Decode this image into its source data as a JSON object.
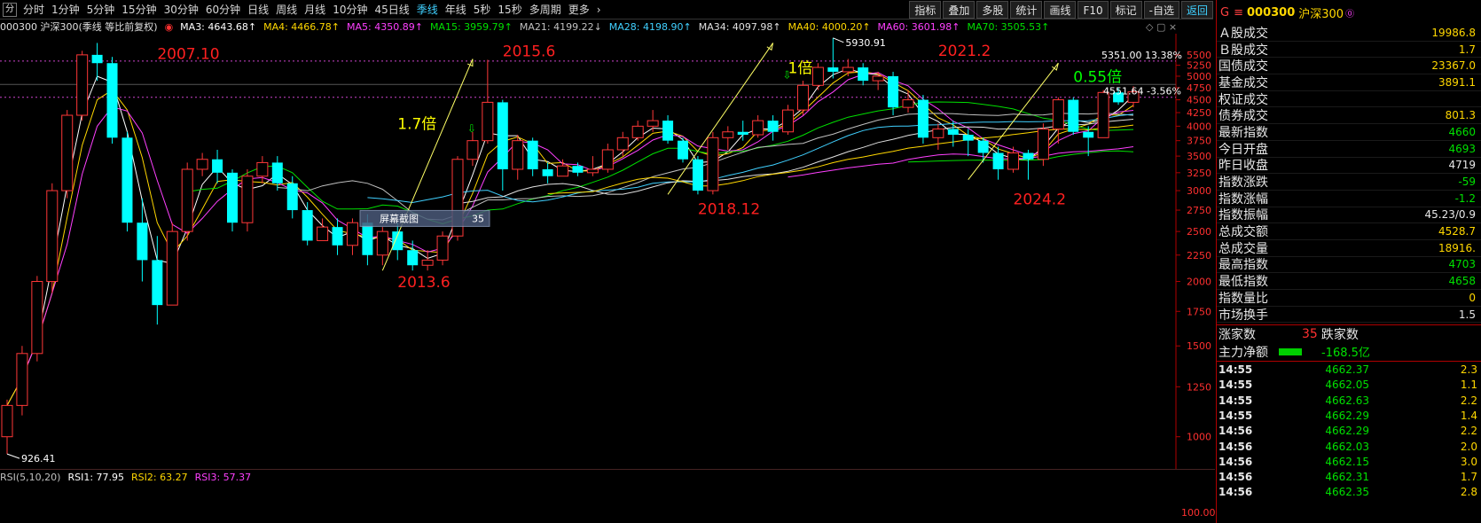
{
  "toolbar": {
    "first_icon": "分",
    "periods": [
      "分时",
      "1分钟",
      "5分钟",
      "15分钟",
      "30分钟",
      "60分钟",
      "日线",
      "周线",
      "月线",
      "10分钟",
      "45日线",
      "季线",
      "年线",
      "5秒",
      "15秒",
      "多周期",
      "更多"
    ],
    "active_period": "季线",
    "more_arrow": "›",
    "tools": [
      "指标",
      "叠加",
      "多股",
      "统计",
      "画线",
      "F10",
      "标记",
      "-自选",
      "返回"
    ]
  },
  "ma_bar": {
    "title": "000300 沪深300(季线 等比前复权)",
    "items": [
      {
        "label": "MA3: 4643.68↑",
        "color": "#ffffff"
      },
      {
        "label": "MA4: 4466.78↑",
        "color": "#ffd700"
      },
      {
        "label": "MA5: 4350.89↑",
        "color": "#ff40ff"
      },
      {
        "label": "MA15: 3959.79↑",
        "color": "#00e000"
      },
      {
        "label": "MA21: 4199.22↓",
        "color": "#c0c0c0"
      },
      {
        "label": "MA28: 4198.90↑",
        "color": "#40d0ff"
      },
      {
        "label": "MA34: 4097.98↑",
        "color": "#e0e0e0"
      },
      {
        "label": "MA40: 4000.20↑",
        "color": "#ffd700"
      },
      {
        "label": "MA60: 3601.98↑",
        "color": "#ff40ff"
      },
      {
        "label": "MA70: 3505.53↑",
        "color": "#00e000"
      }
    ],
    "window_icons": "◇ ▢ ×"
  },
  "chart_data": {
    "type": "candlestick",
    "period": "季线",
    "y_ticks": [
      5500,
      5250,
      5000,
      4750,
      4500,
      4250,
      4000,
      3750,
      3500,
      3250,
      3000,
      2750,
      2500,
      2250,
      2000,
      1750,
      1500,
      1250,
      1000
    ],
    "ylim": [
      880,
      5950
    ],
    "candles": [
      [
        1000,
        1150,
        926,
        1180
      ],
      [
        1150,
        1450,
        1100,
        1500
      ],
      [
        1450,
        2000,
        1400,
        2050
      ],
      [
        2000,
        3000,
        1900,
        3100
      ],
      [
        3000,
        4200,
        2900,
        4300
      ],
      [
        4200,
        5500,
        4100,
        5600
      ],
      [
        5500,
        5300,
        4900,
        5800
      ],
      [
        5300,
        3800,
        3700,
        5450
      ],
      [
        3800,
        2600,
        2500,
        3900
      ],
      [
        2600,
        2200,
        2000,
        2900
      ],
      [
        2200,
        1800,
        1650,
        2450
      ],
      [
        1800,
        2500,
        1800,
        2600
      ],
      [
        2500,
        3300,
        2400,
        3400
      ],
      [
        3300,
        3450,
        3200,
        3550
      ],
      [
        3450,
        3250,
        3100,
        3600
      ],
      [
        3250,
        2600,
        2500,
        3300
      ],
      [
        2600,
        3200,
        2500,
        3300
      ],
      [
        3200,
        3400,
        3100,
        3500
      ],
      [
        3400,
        3100,
        3000,
        3500
      ],
      [
        3100,
        2750,
        2650,
        3200
      ],
      [
        2750,
        2400,
        2350,
        2850
      ],
      [
        2400,
        2550,
        2400,
        2650
      ],
      [
        2550,
        2350,
        2250,
        2650
      ],
      [
        2350,
        2600,
        2250,
        2650
      ],
      [
        2600,
        2250,
        2150,
        2700
      ],
      [
        2250,
        2500,
        2150,
        2550
      ],
      [
        2500,
        2300,
        2200,
        2600
      ],
      [
        2300,
        2150,
        2100,
        2400
      ],
      [
        2150,
        2200,
        2100,
        2300
      ],
      [
        2200,
        2450,
        2150,
        2500
      ],
      [
        2450,
        3450,
        2400,
        3500
      ],
      [
        3450,
        3750,
        3350,
        3900
      ],
      [
        3750,
        4450,
        3700,
        5380
      ],
      [
        4450,
        3300,
        3000,
        4500
      ],
      [
        3300,
        3750,
        3150,
        3850
      ],
      [
        3750,
        3300,
        3200,
        3800
      ],
      [
        3300,
        3200,
        3100,
        3400
      ],
      [
        3200,
        3350,
        3200,
        3450
      ],
      [
        3350,
        3250,
        3200,
        3400
      ],
      [
        3250,
        3300,
        3200,
        3500
      ],
      [
        3300,
        3600,
        3250,
        3700
      ],
      [
        3600,
        3800,
        3500,
        3900
      ],
      [
        3800,
        4000,
        3750,
        4100
      ],
      [
        4000,
        4100,
        3900,
        4300
      ],
      [
        4100,
        3750,
        3700,
        4200
      ],
      [
        3750,
        3450,
        3400,
        3800
      ],
      [
        3450,
        3000,
        2950,
        3500
      ],
      [
        3000,
        3800,
        2950,
        3900
      ],
      [
        3800,
        3900,
        3600,
        4000
      ],
      [
        3900,
        3850,
        3750,
        4100
      ],
      [
        3850,
        4100,
        3800,
        4200
      ],
      [
        4100,
        3900,
        3750,
        4200
      ],
      [
        3900,
        4300,
        3850,
        4400
      ],
      [
        4300,
        4800,
        4200,
        4900
      ],
      [
        4800,
        5200,
        4700,
        5300
      ],
      [
        5200,
        5100,
        4950,
        5930
      ],
      [
        5100,
        5200,
        5000,
        5400
      ],
      [
        5200,
        4900,
        4800,
        5300
      ],
      [
        4900,
        5000,
        4700,
        5100
      ],
      [
        5000,
        4350,
        4200,
        5100
      ],
      [
        4350,
        4500,
        4250,
        4700
      ],
      [
        4500,
        3800,
        3700,
        4600
      ],
      [
        3800,
        3950,
        3600,
        4050
      ],
      [
        3950,
        3850,
        3650,
        4100
      ],
      [
        3850,
        3750,
        3500,
        3950
      ],
      [
        3750,
        3550,
        3400,
        3800
      ],
      [
        3550,
        3300,
        3150,
        3650
      ],
      [
        3300,
        3550,
        3250,
        3650
      ],
      [
        3550,
        3450,
        3150,
        3600
      ],
      [
        3450,
        3950,
        3350,
        4050
      ],
      [
        3950,
        4500,
        3700,
        4550
      ],
      [
        4500,
        3900,
        3850,
        4550
      ],
      [
        3900,
        3800,
        3500,
        4000
      ],
      [
        3800,
        4650,
        3800,
        4700
      ],
      [
        4650,
        4450,
        4400,
        4750
      ],
      [
        4450,
        4662,
        4350,
        4780
      ]
    ],
    "annotations": [
      {
        "text": "2007.10",
        "color": "#ff2020",
        "x": 10,
        "price": 5400
      },
      {
        "text": "2015.6",
        "color": "#ff2020",
        "x": 33,
        "price": 5470
      },
      {
        "text": "2021.2",
        "color": "#ff2020",
        "x": 62,
        "price": 5480
      },
      {
        "text": "1.7倍",
        "color": "#ffff00",
        "x": 26,
        "price": 3950
      },
      {
        "text": "1倍",
        "color": "#ffff00",
        "x": 52,
        "price": 5070
      },
      {
        "text": "0.55倍",
        "color": "#00ff00",
        "x": 71,
        "price": 4870
      },
      {
        "text": "2013.6",
        "color": "#ff2020",
        "x": 26,
        "price": 1950
      },
      {
        "text": "2018.12",
        "color": "#ff2020",
        "x": 46,
        "price": 2700
      },
      {
        "text": "2024.2",
        "color": "#ff2020",
        "x": 67,
        "price": 2820
      }
    ],
    "labels": {
      "low": "926.41",
      "high": "5930.91",
      "target": "5351.00 13.38%",
      "current": "4551.64 -3.56%"
    },
    "popup": {
      "label": "屏幕截图",
      "value": "35"
    }
  },
  "rsi_bar": {
    "items": [
      {
        "label": "RSI(5,10,20)",
        "color": "#c0c0c0"
      },
      {
        "label": "RSI1: 77.95",
        "color": "#ffffff"
      },
      {
        "label": "RSI2: 63.27",
        "color": "#ffd700"
      },
      {
        "label": "RSI3: 57.37",
        "color": "#ff40ff"
      }
    ],
    "axis_label": "100.00"
  },
  "right_panel": {
    "header": {
      "prefix": "G",
      "menu": "≡",
      "code": "000300",
      "name": "沪深300",
      "info": "⓪"
    },
    "stats": [
      {
        "label": "Ａ股成交",
        "value": "19986.8",
        "color": "#ffd700"
      },
      {
        "label": "Ｂ股成交",
        "value": "1.7",
        "color": "#ffd700"
      },
      {
        "label": "国债成交",
        "value": "23367.0",
        "color": "#ffd700"
      },
      {
        "label": "基金成交",
        "value": "3891.1",
        "color": "#ffd700"
      },
      {
        "label": "权证成交",
        "value": "",
        "color": "#ffd700"
      },
      {
        "label": "债券成交",
        "value": "801.3",
        "color": "#ffd700"
      },
      {
        "label": "最新指数",
        "value": "4660",
        "color": "#00e000"
      },
      {
        "label": "今日开盘",
        "value": "4693",
        "color": "#00e000"
      },
      {
        "label": "昨日收盘",
        "value": "4719",
        "color": "#e8e8e8"
      },
      {
        "label": "指数涨跌",
        "value": "-59",
        "color": "#00e000"
      },
      {
        "label": "指数涨幅",
        "value": "-1.2",
        "color": "#00e000"
      },
      {
        "label": "指数振幅",
        "value": "45.23/0.9",
        "color": "#e8e8e8"
      },
      {
        "label": "总成交额",
        "value": "4528.7",
        "color": "#ffd700"
      },
      {
        "label": "总成交量",
        "value": "18916.",
        "color": "#ffd700"
      },
      {
        "label": "最高指数",
        "value": "4703",
        "color": "#00e000"
      },
      {
        "label": "最低指数",
        "value": "4658",
        "color": "#00e000"
      },
      {
        "label": "指数量比",
        "value": "0",
        "color": "#ffd700"
      },
      {
        "label": "市场换手",
        "value": "1.5",
        "color": "#e8e8e8"
      }
    ],
    "updown": {
      "up_label": "涨家数",
      "up_count": "35",
      "down_label": "跌家数"
    },
    "netflow": {
      "label": "主力净额",
      "value": "-168.5亿"
    },
    "ticks": [
      {
        "time": "14:55",
        "price": "4662.37",
        "vol": "2.3"
      },
      {
        "time": "14:55",
        "price": "4662.05",
        "vol": "1.1"
      },
      {
        "time": "14:55",
        "price": "4662.63",
        "vol": "2.2"
      },
      {
        "time": "14:55",
        "price": "4662.29",
        "vol": "1.4"
      },
      {
        "time": "14:56",
        "price": "4662.29",
        "vol": "2.2"
      },
      {
        "time": "14:56",
        "price": "4662.03",
        "vol": "2.0"
      },
      {
        "time": "14:56",
        "price": "4662.15",
        "vol": "3.0"
      },
      {
        "time": "14:56",
        "price": "4662.31",
        "vol": "1.7"
      },
      {
        "time": "14:56",
        "price": "4662.35",
        "vol": "2.8"
      }
    ]
  }
}
